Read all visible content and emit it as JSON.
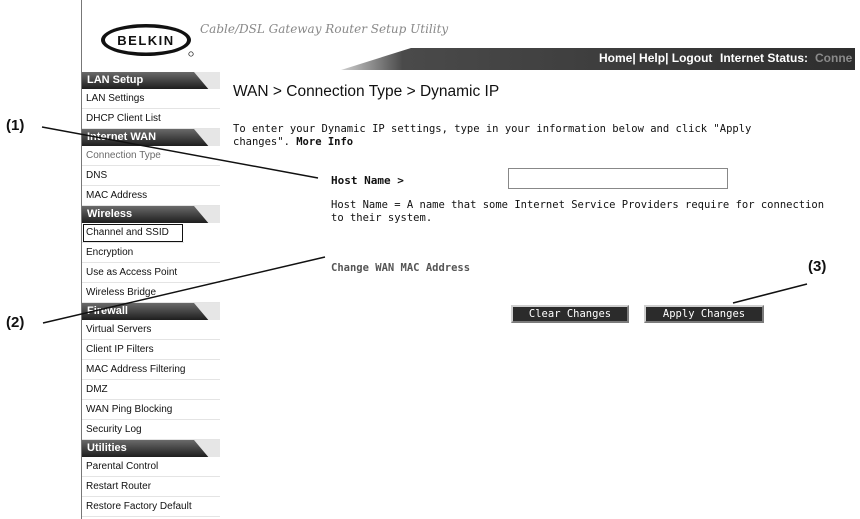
{
  "brand": {
    "logo_text": "BELKIN",
    "tagline": "Cable/DSL Gateway Router Setup Utility"
  },
  "topbar": {
    "links": [
      "Home",
      "Help",
      "Logout"
    ],
    "status_label": "Internet Status:",
    "status_value": "Conne"
  },
  "sidebar": {
    "sections": [
      {
        "title": "LAN Setup",
        "items": [
          "LAN Settings",
          "DHCP Client List"
        ]
      },
      {
        "title": "Internet WAN",
        "items": [
          "Connection Type",
          "DNS",
          "MAC Address"
        ]
      },
      {
        "title": "Wireless",
        "items": [
          "Channel and SSID",
          "Encryption",
          "Use as Access Point",
          "Wireless Bridge"
        ]
      },
      {
        "title": "Firewall",
        "items": [
          "Virtual Servers",
          "Client IP Filters",
          "MAC Address Filtering",
          "DMZ",
          "WAN Ping Blocking",
          "Security Log"
        ]
      },
      {
        "title": "Utilities",
        "items": [
          "Parental Control",
          "Restart Router",
          "Restore Factory Default"
        ]
      }
    ]
  },
  "main": {
    "title": "WAN > Connection Type > Dynamic IP",
    "intro": "To enter your Dynamic IP settings, type in your information below and click \"Apply changes\".",
    "more_info": "More Info",
    "host_label": "Host Name >",
    "host_value": "",
    "host_desc": "Host Name = A name that some Internet Service Providers require for connection to their system.",
    "mac_link": "Change WAN MAC Address",
    "clear_btn": "Clear Changes",
    "apply_btn": "Apply Changes"
  },
  "callouts": {
    "c1": "(1)",
    "c2": "(2)",
    "c3": "(3)"
  },
  "colors": {
    "nav_header": "#1e1e1e",
    "topbar": "#2e2e2e",
    "button": "#2b2b2b"
  }
}
